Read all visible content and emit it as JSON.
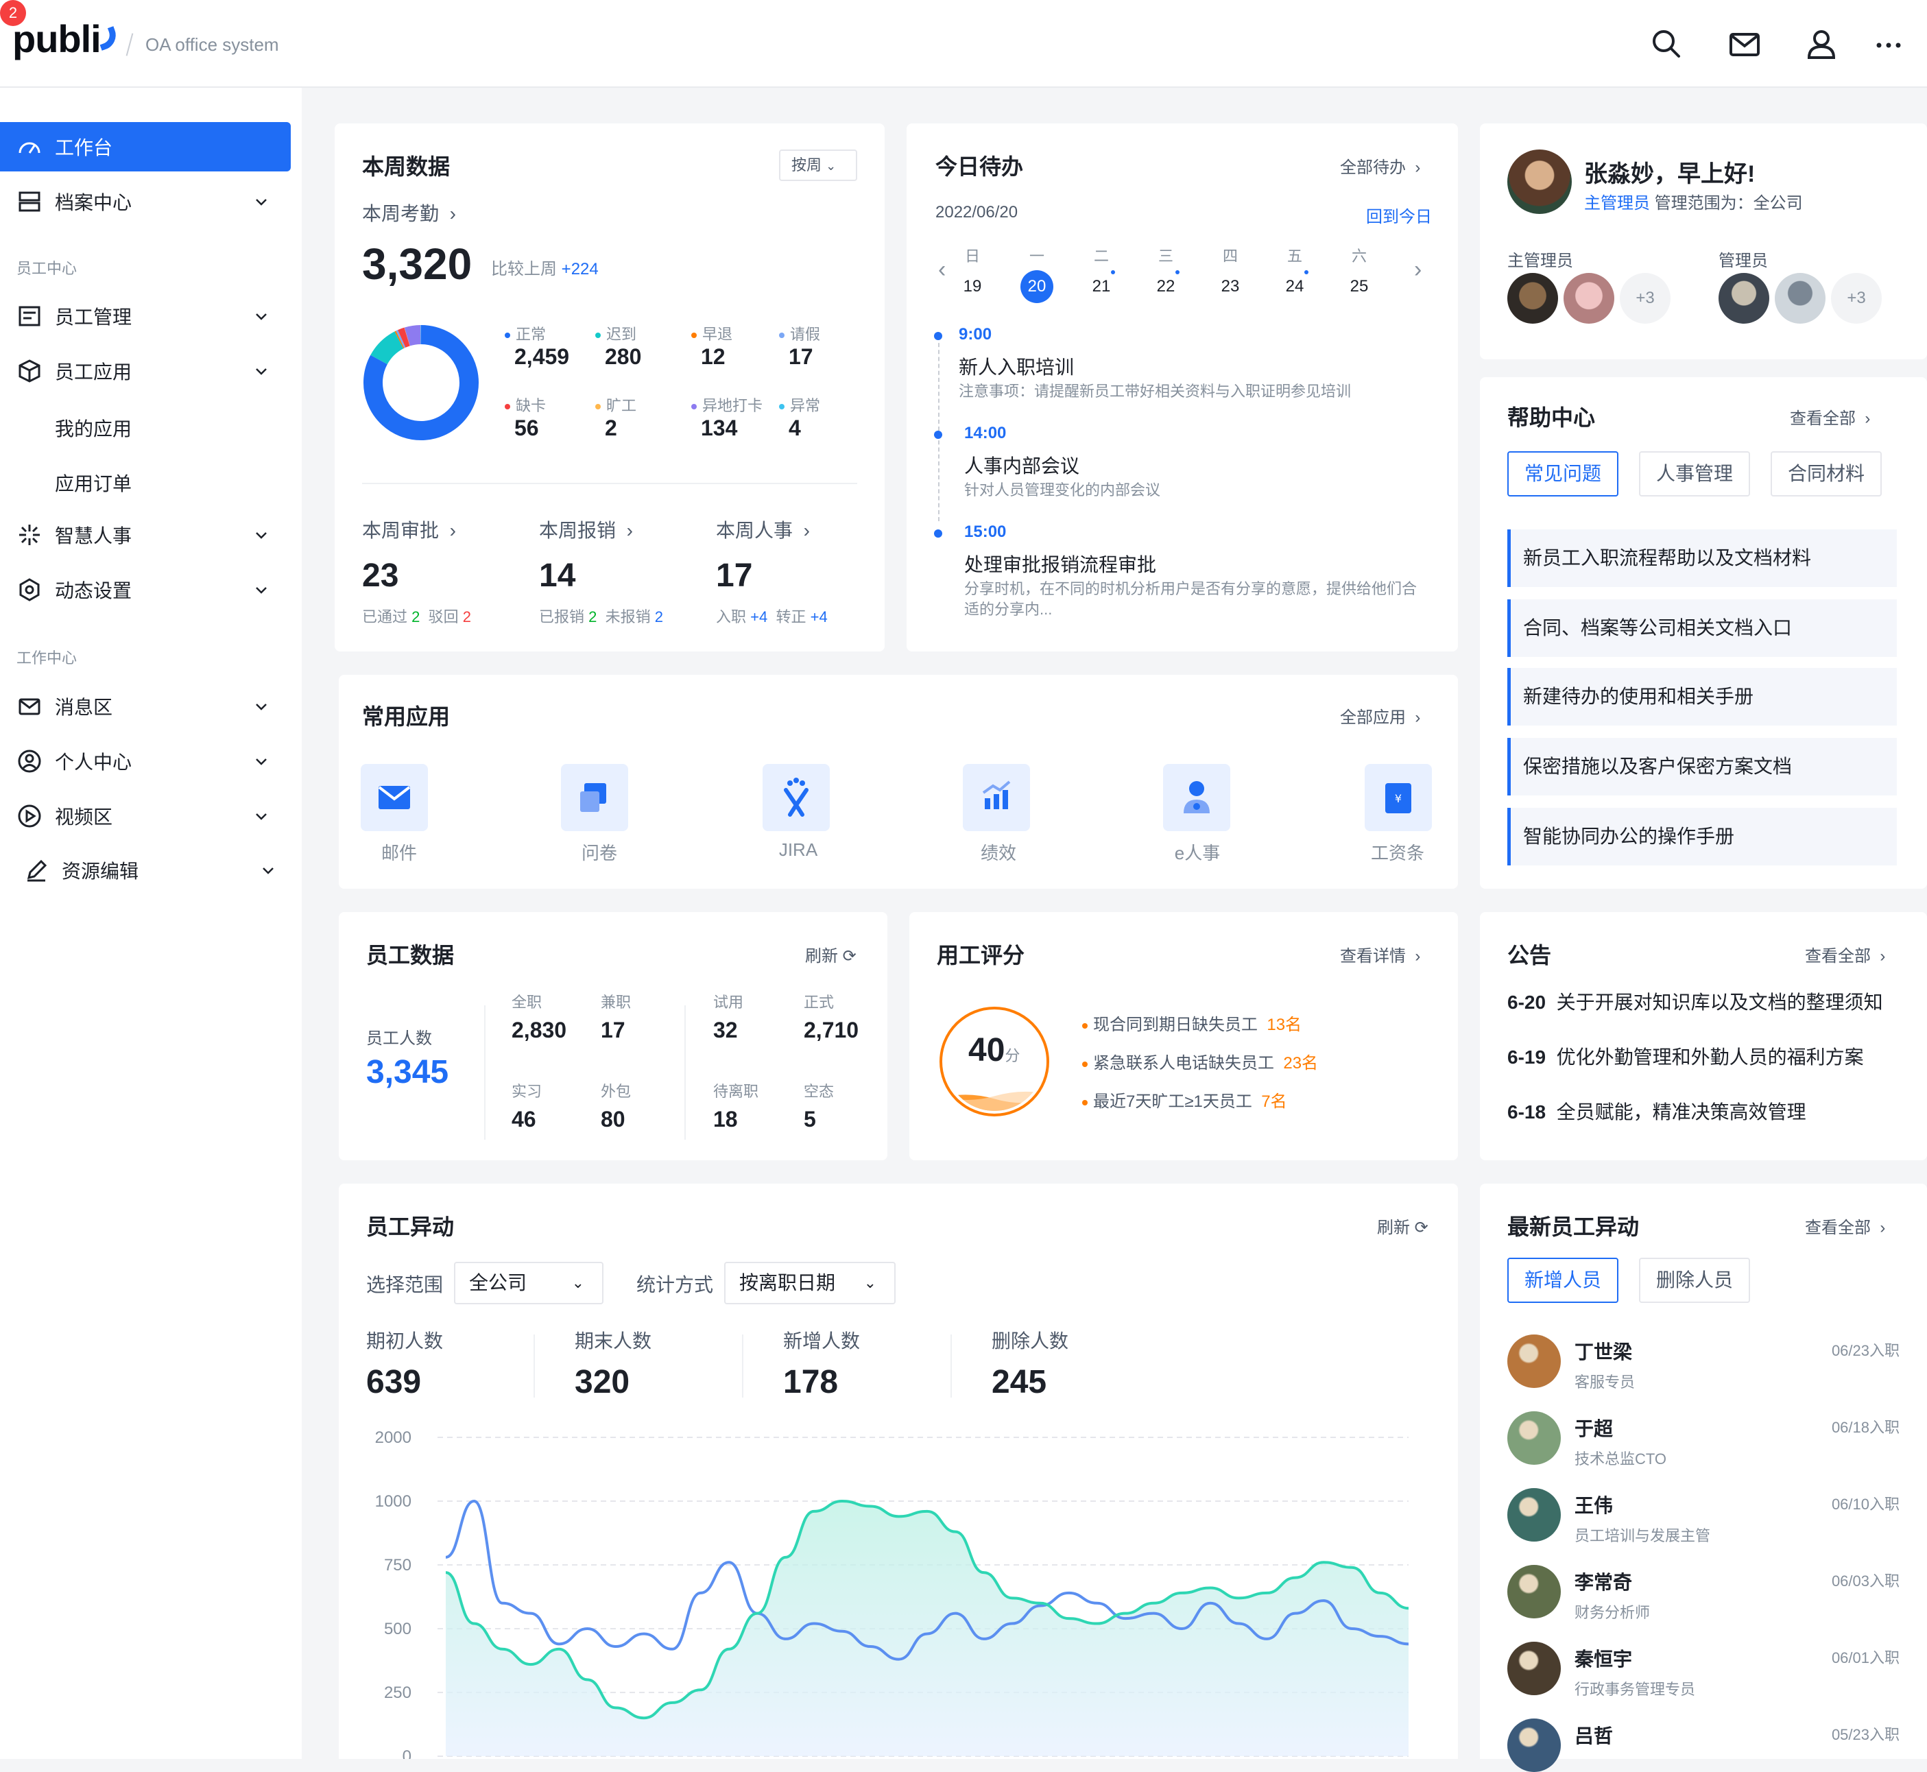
{
  "header": {
    "logo": "publi",
    "subtitle": "OA office system",
    "badge_count": "2"
  },
  "sidebar": {
    "items": [
      {
        "label": "工作台"
      },
      {
        "label": "档案中心"
      },
      {
        "label": "员工管理"
      },
      {
        "label": "员工应用"
      },
      {
        "label": "智慧人事"
      },
      {
        "label": "动态设置"
      },
      {
        "label": "消息区"
      },
      {
        "label": "个人中心"
      },
      {
        "label": "视频区"
      },
      {
        "label": "资源编辑"
      }
    ],
    "section1": "员工中心",
    "section2": "工作中心",
    "sub1": "我的应用",
    "sub2": "应用订单"
  },
  "weekly": {
    "title": "本周数据",
    "range": "按周",
    "attendance_label": "本周考勤",
    "attendance_total": "3,320",
    "compare_label": "比较上周",
    "compare_value": "+224",
    "stats": [
      {
        "label": "正常",
        "value": "2,459",
        "color": "#1f6df5"
      },
      {
        "label": "迟到",
        "value": "280",
        "color": "#14c9c9"
      },
      {
        "label": "早退",
        "value": "12",
        "color": "#ff7d00"
      },
      {
        "label": "请假",
        "value": "17",
        "color": "#7ba7f5"
      },
      {
        "label": "缺卡",
        "value": "56",
        "color": "#f53f3f"
      },
      {
        "label": "旷工",
        "value": "2",
        "color": "#ffb74d"
      },
      {
        "label": "异地打卡",
        "value": "134",
        "color": "#8d7bf0"
      },
      {
        "label": "异常",
        "value": "4",
        "color": "#3cc3f0"
      }
    ],
    "bottom": [
      {
        "label": "本周审批",
        "value": "23",
        "a_label": "已通过",
        "a_value": "2",
        "b_label": "驳回",
        "b_value": "2"
      },
      {
        "label": "本周报销",
        "value": "14",
        "a_label": "已报销",
        "a_value": "2",
        "b_label": "未报销",
        "b_value": "2"
      },
      {
        "label": "本周人事",
        "value": "17",
        "a_label": "入职",
        "a_value": "+4",
        "b_label": "转正",
        "b_value": "+4"
      }
    ]
  },
  "todo": {
    "title": "今日待办",
    "all_label": "全部待办",
    "date": "2022/06/20",
    "back_today": "回到今日",
    "weekdays": [
      "日",
      "一",
      "二",
      "三",
      "四",
      "五",
      "六"
    ],
    "days": [
      "19",
      "20",
      "21",
      "22",
      "23",
      "24",
      "25"
    ],
    "events": [
      {
        "time": "9:00",
        "title": "新人入职培训",
        "desc": "注意事项：请提醒新员工带好相关资料与入职证明参见培训"
      },
      {
        "time": "14:00",
        "title": "人事内部会议",
        "desc": "针对人员管理变化的内部会议"
      },
      {
        "time": "15:00",
        "title": "处理审批报销流程审批",
        "desc": "分享时机，在不同的时机分析用户是否有分享的意愿，提供给他们合适的分享内..."
      }
    ]
  },
  "profile": {
    "greeting": "张淼妙，早上好!",
    "role": "主管理员",
    "scope": "管理范围为：全公司",
    "group1": "主管理员",
    "group2": "管理员",
    "more1": "+3",
    "more2": "+3"
  },
  "help": {
    "title": "帮助中心",
    "all_label": "查看全部",
    "tabs": [
      "常见问题",
      "人事管理",
      "合同材料"
    ],
    "items": [
      "新员工入职流程帮助以及文档材料",
      "合同、档案等公司相关文档入口",
      "新建待办的使用和相关手册",
      "保密措施以及客户保密方案文档",
      "智能协同办公的操作手册"
    ]
  },
  "apps": {
    "title": "常用应用",
    "all_label": "全部应用",
    "items": [
      {
        "label": "邮件",
        "icon": "mail-icon"
      },
      {
        "label": "问卷",
        "icon": "survey-icon"
      },
      {
        "label": "JIRA",
        "icon": "jira-icon"
      },
      {
        "label": "绩效",
        "icon": "performance-icon"
      },
      {
        "label": "e人事",
        "icon": "person-icon"
      },
      {
        "label": "工资条",
        "icon": "payslip-icon"
      }
    ]
  },
  "employee_data": {
    "title": "员工数据",
    "refresh": "刷新",
    "total_label": "员工人数",
    "total": "3,345",
    "cells": [
      {
        "label": "全职",
        "value": "2,830"
      },
      {
        "label": "兼职",
        "value": "17"
      },
      {
        "label": "试用",
        "value": "32"
      },
      {
        "label": "正式",
        "value": "2,710"
      },
      {
        "label": "实习",
        "value": "46"
      },
      {
        "label": "外包",
        "value": "80"
      },
      {
        "label": "待离职",
        "value": "18"
      },
      {
        "label": "空态",
        "value": "5"
      }
    ]
  },
  "score": {
    "title": "用工评分",
    "detail": "查看详情",
    "value": "40",
    "unit": "分",
    "level": 0.4,
    "items": [
      {
        "text": "现合同到期日缺失员工",
        "count": "13名"
      },
      {
        "text": "紧急联系人电话缺失员工",
        "count": "23名"
      },
      {
        "text": "最近7天旷工≥1天员工",
        "count": "7名"
      }
    ]
  },
  "notice": {
    "title": "公告",
    "all_label": "查看全部",
    "items": [
      {
        "date": "6-20",
        "text": "关于开展对知识库以及文档的整理须知"
      },
      {
        "date": "6-19",
        "text": "优化外勤管理和外勤人员的福利方案"
      },
      {
        "date": "6-18",
        "text": "全员赋能，精准决策高效管理"
      }
    ]
  },
  "changes": {
    "title": "员工异动",
    "refresh": "刷新",
    "scope_label": "选择范围",
    "scope_value": "全公司",
    "method_label": "统计方式",
    "method_value": "按离职日期",
    "stats": [
      {
        "label": "期初人数",
        "value": "639"
      },
      {
        "label": "期末人数",
        "value": "320"
      },
      {
        "label": "新增人数",
        "value": "178"
      },
      {
        "label": "删除人数",
        "value": "245"
      }
    ]
  },
  "chart_data": {
    "type": "area",
    "y_ticks": [
      "2000",
      "1000",
      "750",
      "500",
      "250",
      "0"
    ],
    "series": [
      {
        "color": "#5b8ff0",
        "values": [
          780,
          1000,
          600,
          560,
          440,
          500,
          430,
          480,
          420,
          640,
          760,
          560,
          460,
          520,
          490,
          430,
          380,
          480,
          560,
          460,
          520,
          590,
          640,
          600,
          540,
          560,
          500,
          600,
          520,
          460,
          560,
          610,
          500,
          470,
          440
        ]
      },
      {
        "color": "#2ed6b3",
        "values": [
          720,
          520,
          420,
          360,
          420,
          300,
          190,
          150,
          210,
          260,
          420,
          560,
          780,
          960,
          1000,
          980,
          940,
          960,
          880,
          720,
          620,
          600,
          540,
          520,
          560,
          600,
          640,
          660,
          620,
          640,
          700,
          760,
          740,
          640,
          580
        ]
      }
    ]
  },
  "recent": {
    "title": "最新员工异动",
    "all_label": "查看全部",
    "tabs": [
      "新增人员",
      "删除人员"
    ],
    "people": [
      {
        "name": "丁世梁",
        "role": "客服专员",
        "date": "06/23入职",
        "color": "#b8763c"
      },
      {
        "name": "于超",
        "role": "技术总监CTO",
        "date": "06/18入职",
        "color": "#7fa07a"
      },
      {
        "name": "王伟",
        "role": "员工培训与发展主管",
        "date": "06/10入职",
        "color": "#3c6d66"
      },
      {
        "name": "李常奇",
        "role": "财务分析师",
        "date": "06/03入职",
        "color": "#5f6e4a"
      },
      {
        "name": "秦恒宇",
        "role": "行政事务管理专员",
        "date": "06/01入职",
        "color": "#4a3d2e"
      },
      {
        "name": "吕哲",
        "role": "",
        "date": "05/23入职",
        "color": "#3b5a7a"
      }
    ]
  }
}
